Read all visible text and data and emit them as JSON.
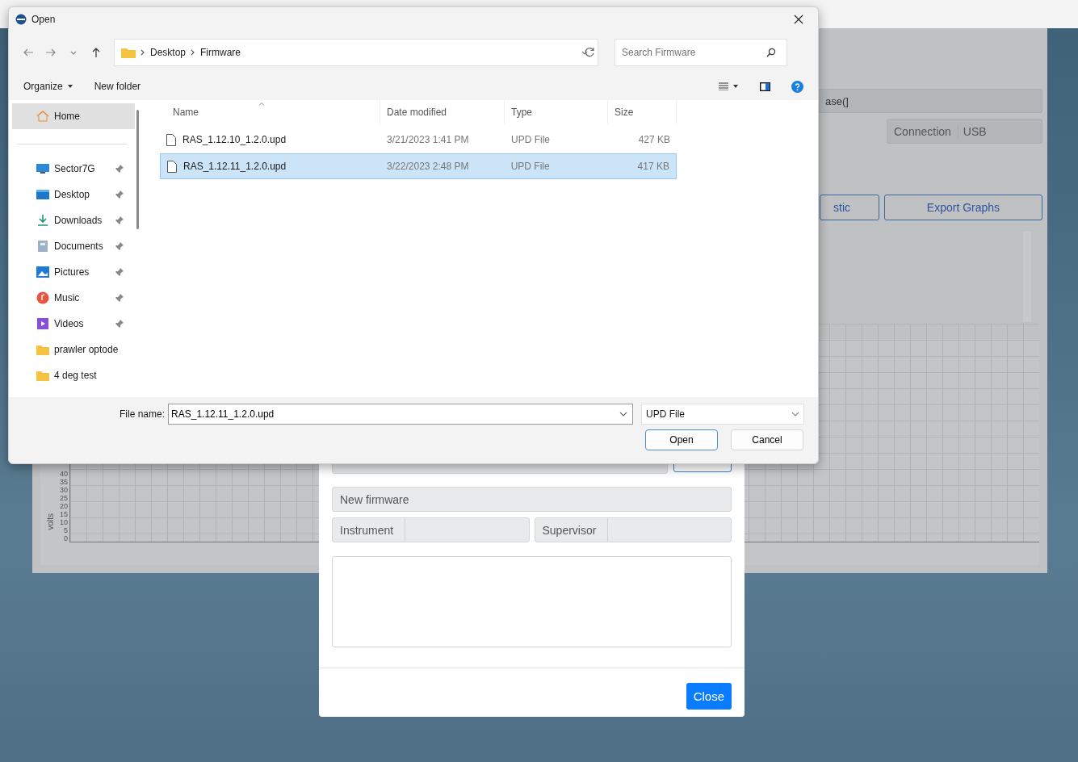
{
  "background_app": {
    "field_text": "ase(]",
    "connection": {
      "label": "Connection",
      "value": "USB"
    },
    "buttons": [
      "stic",
      "Export Graphs"
    ],
    "graph": {
      "ylabel": "volts",
      "ytick_labels": [
        "40",
        "35",
        "30",
        "25",
        "20",
        "15",
        "10",
        "5",
        "0"
      ]
    }
  },
  "modal": {
    "new_firmware_label": "New firmware",
    "fields": [
      {
        "label": "Instrument"
      },
      {
        "label": "Supervisor"
      }
    ],
    "close_button": "Close"
  },
  "open_dialog": {
    "title": "Open",
    "breadcrumb": [
      "Desktop",
      "Firmware"
    ],
    "search": {
      "placeholder": "Search Firmware"
    },
    "toolbar": {
      "organize": "Organize",
      "new_folder": "New folder"
    },
    "sidebar": [
      {
        "label": "Home",
        "pinned": false,
        "selected": true
      },
      {
        "label": "Sector7G",
        "pinned": true,
        "selected": false
      },
      {
        "label": "Desktop",
        "pinned": true,
        "selected": false
      },
      {
        "label": "Downloads",
        "pinned": true,
        "selected": false
      },
      {
        "label": "Documents",
        "pinned": true,
        "selected": false
      },
      {
        "label": "Pictures",
        "pinned": true,
        "selected": false
      },
      {
        "label": "Music",
        "pinned": true,
        "selected": false
      },
      {
        "label": "Videos",
        "pinned": true,
        "selected": false
      },
      {
        "label": "prawler optode",
        "pinned": false,
        "selected": false
      },
      {
        "label": "4 deg test",
        "pinned": false,
        "selected": false
      }
    ],
    "columns": [
      "Name",
      "Date modified",
      "Type",
      "Size"
    ],
    "rows": [
      {
        "name": "RAS_1.12.10_1.2.0.upd",
        "date": "3/21/2023 1:41 PM",
        "type": "UPD File",
        "size": "427 KB",
        "selected": false
      },
      {
        "name": "RAS_1.12.11_1.2.0.upd",
        "date": "3/22/2023 2:48 PM",
        "type": "UPD File",
        "size": "417 KB",
        "selected": true
      }
    ],
    "file_name": {
      "label": "File name:",
      "value": "RAS_1.12.11_1.2.0.upd"
    },
    "file_type": "UPD File",
    "buttons": {
      "open": "Open",
      "cancel": "Cancel"
    }
  }
}
